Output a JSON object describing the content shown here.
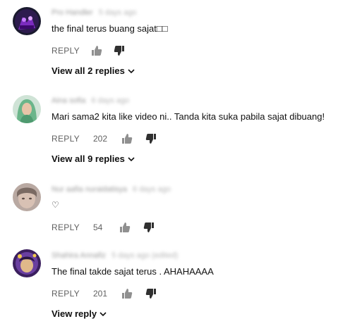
{
  "comments": [
    {
      "author": "Pro Handler",
      "time": "5 days ago",
      "text": "the final terus buang sajat□□",
      "reply_label": "REPLY",
      "likes": "",
      "replies_label": "View all 2 replies",
      "avatar_icon": "gamer-avatar-icon"
    },
    {
      "author": "Aina sofia",
      "time": "6 days ago",
      "text": "Mari sama2 kita like video ni.. Tanda kita suka pabila sajat dibuang!",
      "reply_label": "REPLY",
      "likes": "202",
      "replies_label": "View all 9 replies",
      "avatar_icon": "hijab-avatar-icon"
    },
    {
      "author": "Nur aafia nuraidatisya",
      "time": "6 days ago",
      "text": "♡",
      "reply_label": "REPLY",
      "likes": "54",
      "replies_label": "",
      "avatar_icon": "face-avatar-icon"
    },
    {
      "author": "Shahira Annafiz",
      "time": "5 days ago (edited)",
      "text": "The final takde sajat terus . AHAHAAAA",
      "reply_label": "REPLY",
      "likes": "201",
      "replies_label": "View reply",
      "avatar_icon": "purple-avatar-icon"
    }
  ],
  "colors": {
    "meta_text": "#606060",
    "primary_text": "#0f0f0f",
    "background": "#ffffff"
  }
}
